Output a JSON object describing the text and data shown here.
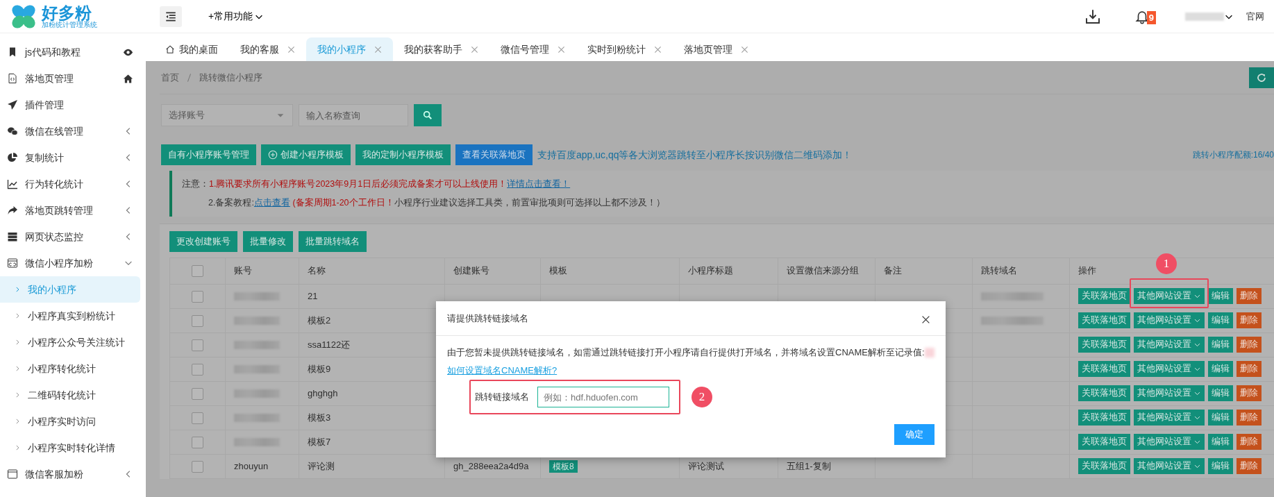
{
  "header": {
    "logo_title": "好多粉",
    "logo_subtitle": "加粉统计管理系统",
    "quick_menu": "+常用功能",
    "notification_count": "9",
    "user_redacted": true,
    "site_link": "官网"
  },
  "sidebar": {
    "items": [
      {
        "label": "js代码和教程",
        "kind": "link"
      },
      {
        "label": "落地页管理",
        "kind": "link"
      },
      {
        "label": "插件管理",
        "kind": "plain"
      },
      {
        "label": "微信在线管理",
        "kind": "group",
        "expanded": false
      },
      {
        "label": "复制统计",
        "kind": "group",
        "expanded": false
      },
      {
        "label": "行为转化统计",
        "kind": "group",
        "expanded": false
      },
      {
        "label": "落地页跳转管理",
        "kind": "group",
        "expanded": false
      },
      {
        "label": "网页状态监控",
        "kind": "group",
        "expanded": false
      },
      {
        "label": "微信小程序加粉",
        "kind": "group",
        "expanded": true,
        "children": [
          {
            "label": "我的小程序",
            "selected": true
          },
          {
            "label": "小程序真实到粉统计",
            "selected": false
          },
          {
            "label": "小程序公众号关注统计",
            "selected": false
          },
          {
            "label": "小程序转化统计",
            "selected": false
          },
          {
            "label": "二维码转化统计",
            "selected": false
          },
          {
            "label": "小程序实时访问",
            "selected": false
          },
          {
            "label": "小程序实时转化详情",
            "selected": false
          }
        ]
      },
      {
        "label": "微信客服加粉",
        "kind": "group",
        "expanded": false
      }
    ]
  },
  "tabs": [
    {
      "label": "我的桌面",
      "closable": false,
      "selected": false
    },
    {
      "label": "我的客服",
      "closable": true,
      "selected": false
    },
    {
      "label": "我的小程序",
      "closable": true,
      "selected": true
    },
    {
      "label": "我的获客助手",
      "closable": true,
      "selected": false
    },
    {
      "label": "微信号管理",
      "closable": true,
      "selected": false
    },
    {
      "label": "实时到粉统计",
      "closable": true,
      "selected": false
    },
    {
      "label": "落地页管理",
      "closable": true,
      "selected": false
    }
  ],
  "breadcrumb": [
    "首页",
    "跳转微信小程序"
  ],
  "filters": {
    "account_select": "选择账号",
    "name_placeholder": "输入名称查询"
  },
  "toolbar": {
    "buttons": [
      {
        "label": "自有小程序账号管理",
        "kind": "primary"
      },
      {
        "label": "创建小程序模板",
        "kind": "add"
      },
      {
        "label": "我的定制小程序模板",
        "kind": "primary"
      },
      {
        "label": "查看关联落地页",
        "kind": "info"
      }
    ],
    "promo": "支持百度app,uc,qq等各大浏览器跳转至小程序长按识别微信二维码添加！",
    "quota": "跳转小程序配额:16/40"
  },
  "notice": {
    "lines": [
      [
        {
          "kind": "text",
          "text": "注意："
        },
        {
          "kind": "warn",
          "text": "1.腾讯要求所有小程序账号2023年9月1日后必须完成备案才可以上线使用！"
        },
        {
          "kind": "link",
          "text": "详情点击查看！"
        }
      ],
      [
        {
          "kind": "text",
          "text": "2.备案教程:"
        },
        {
          "kind": "link",
          "text": "点击查看"
        },
        {
          "kind": "warn",
          "text": " (备案周期1-20个工作日！"
        },
        {
          "kind": "text",
          "text": "小程序行业建议选择工具类，前置审批项则可选择以上都不涉及！）"
        }
      ]
    ]
  },
  "batch_buttons": [
    "更改创建账号",
    "批量修改",
    "批量跳转域名"
  ],
  "table": {
    "select_all_checked": false,
    "columns": [
      "账号",
      "名称",
      "创建账号",
      "模板",
      "小程序标题",
      "设置微信来源分组",
      "备注",
      "跳转域名",
      "操作"
    ],
    "rows": [
      {
        "checked": false,
        "account_redacted": true,
        "name": "21",
        "domain_redacted": true,
        "actions": [
          "关联落地页",
          "其他网站设置",
          "编辑",
          "删除"
        ],
        "annotation": "1"
      },
      {
        "checked": false,
        "account_redacted": true,
        "name": "模板2",
        "domain_redacted": true,
        "actions": [
          "关联落地页",
          "其他网站设置",
          "编辑",
          "删除"
        ]
      },
      {
        "checked": false,
        "account_redacted": true,
        "name": "ssa1122还",
        "actions": [
          "关联落地页",
          "其他网站设置",
          "编辑",
          "删除"
        ]
      },
      {
        "checked": false,
        "account_redacted": true,
        "name": "模板9",
        "actions": [
          "关联落地页",
          "其他网站设置",
          "编辑",
          "删除"
        ]
      },
      {
        "checked": false,
        "account_redacted": true,
        "name": "ghghgh",
        "actions": [
          "关联落地页",
          "其他网站设置",
          "编辑",
          "删除"
        ]
      },
      {
        "checked": false,
        "account_redacted": true,
        "name": "模板3",
        "actions": [
          "关联落地页",
          "其他网站设置",
          "编辑",
          "删除"
        ]
      },
      {
        "checked": false,
        "account_redacted": true,
        "name": "模板7",
        "actions": [
          "关联落地页",
          "其他网站设置",
          "编辑",
          "删除"
        ]
      },
      {
        "checked": false,
        "account": "zhouyun",
        "name": "评论测",
        "creator": "gh_288eea2a4d9a",
        "template": "模板8",
        "title": "评论测试",
        "group": "五组1-复制",
        "actions": [
          "关联落地页",
          "其他网站设置",
          "编辑",
          "删除"
        ]
      }
    ]
  },
  "modal": {
    "title": "请提供跳转链接域名",
    "message": "由于您暂未提供跳转链接域名，如需通过跳转链接打开小程序请自行提供打开域名，并将域名设置CNAME解析至记录值:",
    "record_redacted": true,
    "help_link": "如何设置域名CNAME解析?",
    "field_label": "跳转链接域名",
    "field_placeholder": "例如：hdf.hduofen.com",
    "confirm": "确定",
    "annotation": "2"
  }
}
